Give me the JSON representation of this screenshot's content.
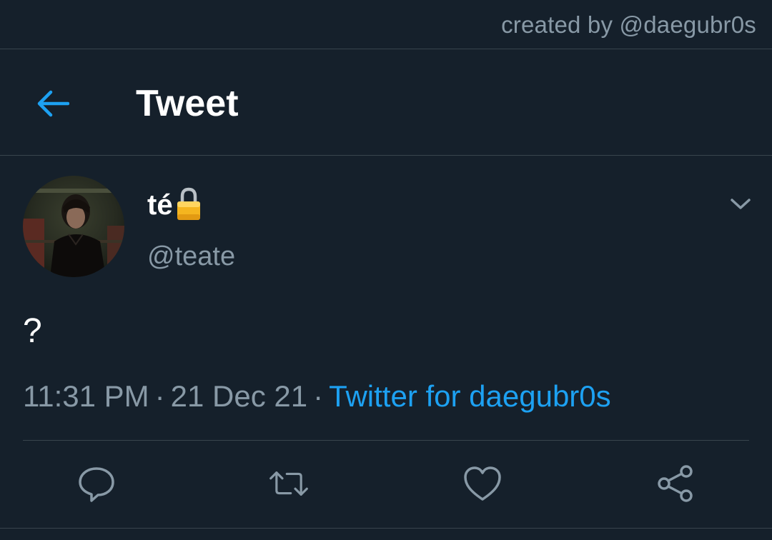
{
  "watermark": {
    "text": "created by @daegubr0s"
  },
  "header": {
    "title": "Tweet",
    "back_icon": "arrow-left-icon",
    "accent_color": "#1da1f2"
  },
  "tweet": {
    "author": {
      "display_name": "té",
      "badge_icon": "lock-icon",
      "handle": "@teate",
      "avatar_icon": "profile-photo"
    },
    "text": "?",
    "time": "11:31 PM",
    "date": "21 Dec 21",
    "separator": "·",
    "source": "Twitter for daegubr0s",
    "more_icon": "chevron-down-icon"
  },
  "actions": [
    {
      "name": "reply",
      "icon": "reply-icon"
    },
    {
      "name": "retweet",
      "icon": "retweet-icon"
    },
    {
      "name": "like",
      "icon": "heart-icon"
    },
    {
      "name": "share",
      "icon": "share-icon"
    }
  ],
  "colors": {
    "background": "#15202b",
    "divider": "#38444d",
    "secondary_text": "#8899a6",
    "primary_text": "#ffffff",
    "link": "#1da1f2"
  }
}
